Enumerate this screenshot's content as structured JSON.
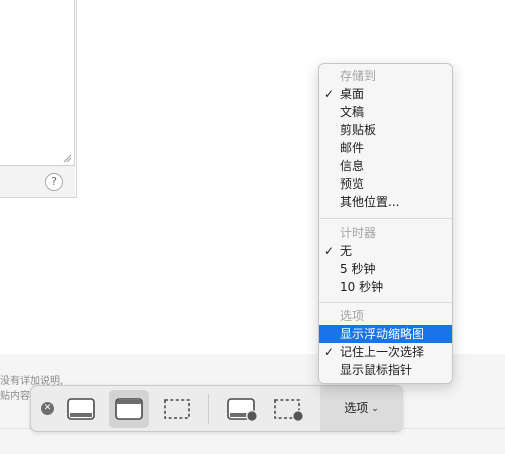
{
  "background_window": {
    "help_label": "?",
    "partial_text_line1": "没有详加说明,",
    "partial_text_line2": "贴内容"
  },
  "toolbar": {
    "close_label": "✕",
    "options_label": "选项",
    "options_chevron": "⌄"
  },
  "menu": {
    "save_to_header": "存储到",
    "save_to_items": [
      "桌面",
      "文稿",
      "剪贴板",
      "邮件",
      "信息",
      "预览",
      "其他位置..."
    ],
    "save_to_checked_index": 0,
    "timer_header": "计时器",
    "timer_items": [
      "无",
      "5 秒钟",
      "10 秒钟"
    ],
    "timer_checked_index": 0,
    "options_header": "选项",
    "options_items": [
      "显示浮动缩略图",
      "记住上一次选择",
      "显示鼠标指针"
    ],
    "options_highlighted_index": 0,
    "options_checked_index": 1,
    "checkmark": "✓"
  },
  "colors": {
    "highlight": "#1a74e8",
    "menu_bg": "#f6f6f6",
    "toolbar_bg": "#ececec",
    "header_text": "#a3a3a3"
  }
}
